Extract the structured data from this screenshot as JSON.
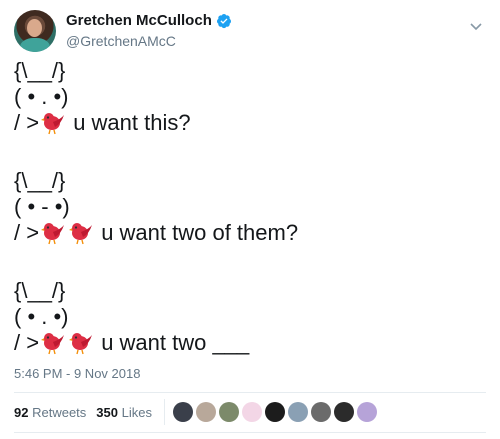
{
  "author": {
    "display_name": "Gretchen McCulloch",
    "handle": "@GretchenAMcC",
    "verified_icon": "verified-badge-icon",
    "menu_icon": "chevron-down-icon"
  },
  "tweet": {
    "blocks": [
      {
        "line1": "{\\__/}",
        "line2": "( • . •)",
        "line3_prefix": "/ >",
        "birds": 1,
        "line3_suffix": " u want this?"
      },
      {
        "line1": "{\\__/}",
        "line2": "( • - •)",
        "line3_prefix": "/ >",
        "birds": 2,
        "line3_suffix": " u want two of them?"
      },
      {
        "line1": "{\\__/}",
        "line2": "( • . •)",
        "line3_prefix": "/ >",
        "birds": 2,
        "line3_suffix": " u want two ___"
      }
    ],
    "emoji": "red-bird-emoji",
    "timestamp": "5:46 PM - 9 Nov 2018"
  },
  "stats": {
    "retweets_count": "92",
    "retweets_label": "Retweets",
    "likes_count": "350",
    "likes_label": "Likes"
  },
  "likers": [
    {
      "name": "liker-avatar-1",
      "color": "#3a3f4a"
    },
    {
      "name": "liker-avatar-2",
      "color": "#b8a89a"
    },
    {
      "name": "liker-avatar-3",
      "color": "#7c8a6a"
    },
    {
      "name": "liker-avatar-4",
      "color": "#f3d6e6"
    },
    {
      "name": "liker-avatar-5",
      "color": "#1c1c1c"
    },
    {
      "name": "liker-avatar-6",
      "color": "#8aa0b4"
    },
    {
      "name": "liker-avatar-7",
      "color": "#6b6b6b"
    },
    {
      "name": "liker-avatar-8",
      "color": "#2b2b2b"
    },
    {
      "name": "liker-avatar-9",
      "color": "#b6a3d8"
    }
  ],
  "colors": {
    "verified": "#1da1f2",
    "bird": "#dd2e44",
    "muted": "#657786"
  }
}
